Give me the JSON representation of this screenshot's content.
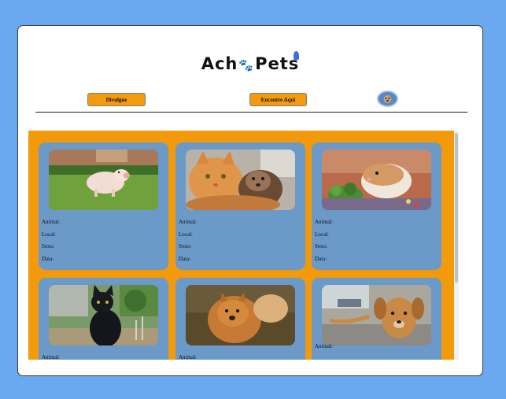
{
  "brand": {
    "name_left": "Ach",
    "name_right": "Pets"
  },
  "nav": {
    "divulgue_label": "Divulgue",
    "encontre_label": "Encontre Aqui"
  },
  "card_fields": {
    "animal": "Animal:",
    "local": "Local:",
    "sexo": "Sexo:",
    "data": "Data:"
  },
  "cards": [
    {
      "photo": "pig"
    },
    {
      "photo": "cat-and-otter"
    },
    {
      "photo": "hamster"
    },
    {
      "photo": "black-cat"
    },
    {
      "photo": "chow-chow"
    },
    {
      "photo": "brown-dog"
    }
  ],
  "colors": {
    "background": "#6aa9f0",
    "accent": "#f39a0e",
    "card": "#6b99c8"
  }
}
